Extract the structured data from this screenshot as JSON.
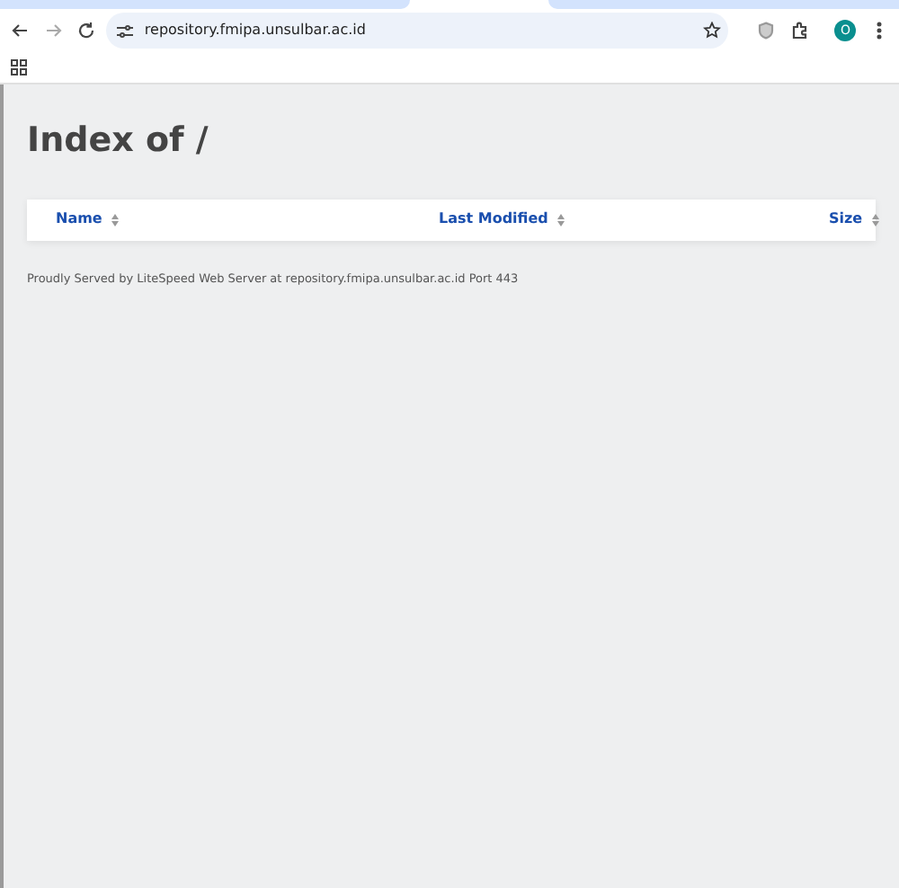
{
  "browser": {
    "url": "repository.fmipa.unsulbar.ac.id",
    "avatar": "O"
  },
  "page": {
    "title": "Index of /",
    "columns": [
      {
        "label": "Name"
      },
      {
        "label": "Last Modified"
      },
      {
        "label": "Size"
      }
    ],
    "footer": "Proudly Served by LiteSpeed Web Server at repository.fmipa.unsulbar.ac.id Port 443"
  }
}
